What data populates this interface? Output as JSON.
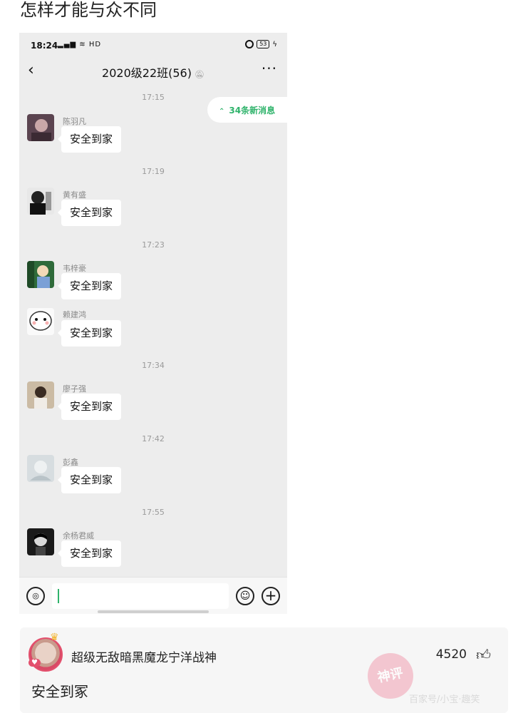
{
  "post": {
    "title": "怎样才能与众不同"
  },
  "statusbar": {
    "time": "18:24",
    "network": "HD",
    "battery": "53"
  },
  "chat": {
    "title": "2020级22班(56)",
    "new_messages": "34条新消息",
    "messages": [
      {
        "time": "17:15",
        "sender": "陈羽凡",
        "text": "安全到家"
      },
      {
        "time": "17:19",
        "sender": "黄有盛",
        "text": "安全到家"
      },
      {
        "time": "17:23",
        "sender": "韦梓豪",
        "text": "安全到家"
      },
      {
        "time": "",
        "sender": "赖建鸿",
        "text": "安全到家"
      },
      {
        "time": "17:34",
        "sender": "廖子强",
        "text": "安全到家"
      },
      {
        "time": "17:42",
        "sender": "彭鑫",
        "text": "安全到家"
      },
      {
        "time": "17:55",
        "sender": "余杨君威",
        "text": "安全到家"
      }
    ]
  },
  "comment": {
    "username": "超级无敌暗黑魔龙宁洋战神",
    "likes": "4520",
    "text": "安全到冢",
    "stamp": "神评",
    "watermark": "百家号/小宝·趣笑"
  },
  "colors": {
    "accent_green": "#2fb36b",
    "chat_bg": "#ededed"
  },
  "icons": [
    "back-arrow-icon",
    "bell-muted-icon",
    "more-dots-icon",
    "voice-icon",
    "emoji-icon",
    "plus-icon",
    "thumb-up-icon",
    "alarm-icon",
    "battery-icon"
  ]
}
